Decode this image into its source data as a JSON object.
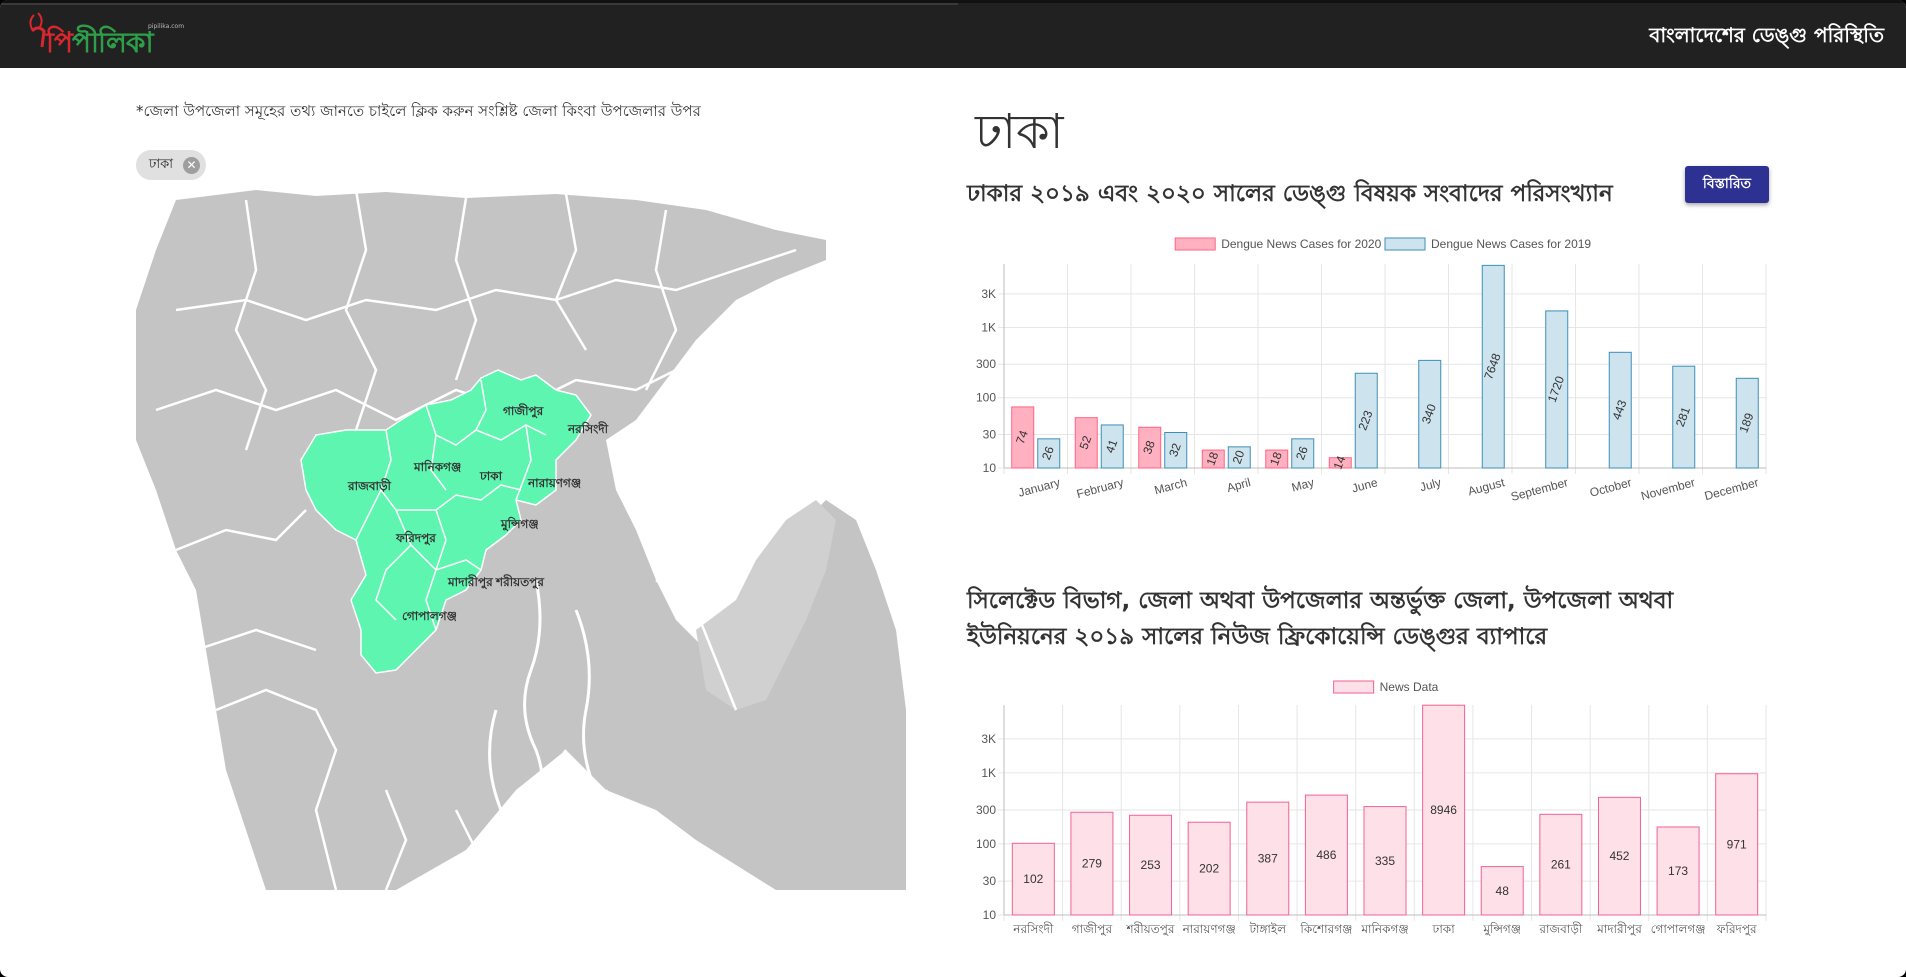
{
  "header": {
    "logo_text_red": "পি",
    "logo_text_green": "পীলিকা",
    "logo_url": "pipilika.com",
    "site_title": "বাংলাদেশের ডেঙ্গু পরিস্থিতি"
  },
  "sidebar": {
    "hint": "*জেলা উপজেলা সমূহের তথ্য জানতে চাইলে ক্লিক করুন সংশ্লিষ্ট জেলা কিংবা উপজেলার উপর",
    "chip_label": "ঢাকা"
  },
  "map": {
    "base_color": "#c4c4c4",
    "selected_color": "#5ef5b0",
    "border_color": "#ffffff",
    "labels": [
      {
        "id": "gazipur",
        "text": "গাজীপুর"
      },
      {
        "id": "narsingdi",
        "text": "নরসিংদী"
      },
      {
        "id": "manikganj",
        "text": "মানিকগঞ্জ"
      },
      {
        "id": "dhaka",
        "text": "ঢাকা"
      },
      {
        "id": "narayanganj",
        "text": "নারায়ণগঞ্জ"
      },
      {
        "id": "rajbari",
        "text": "রাজবাড়ী"
      },
      {
        "id": "munshiganj",
        "text": "মুন্সিগঞ্জ"
      },
      {
        "id": "faridpur",
        "text": "ফরিদপুর"
      },
      {
        "id": "madaripur",
        "text": "মাদারীপুর"
      },
      {
        "id": "shariatpur",
        "text": "শরীয়তপুর"
      },
      {
        "id": "gopalganj",
        "text": "গোপালগঞ্জ"
      }
    ]
  },
  "main": {
    "district_title": "ঢাকা",
    "chart1_heading": "ঢাকার ২০১৯ এবং ২০২০ সালের ডেঙ্গু বিষয়ক সংবাদের পরিসংখ্যান",
    "details_button": "বিস্তারিত",
    "chart2_heading": "সিলেক্টেড বিভাগ, জেলা অথবা উপজেলার অন্তর্ভুক্ত জেলা, উপজেলা অথবা ইউনিয়নের ২০১৯ সালের নিউজ ফ্রিকোয়েন্সি ডেঙ্গুর ব্যাপারে"
  },
  "chart_data": [
    {
      "type": "bar",
      "scale": "log",
      "yticks": [
        "10",
        "30",
        "100",
        "300",
        "1K",
        "3K"
      ],
      "ytick_values": [
        10,
        30,
        100,
        300,
        1000,
        3000
      ],
      "ylim": [
        10,
        8000
      ],
      "grid": true,
      "legend": "top-center",
      "categories": [
        "January",
        "February",
        "March",
        "April",
        "May",
        "June",
        "July",
        "August",
        "September",
        "October",
        "November",
        "December"
      ],
      "series": [
        {
          "name": "Dengue News Cases for 2020",
          "color": "#ff6384",
          "fill": "#ffb1c1",
          "values": [
            74,
            52,
            38,
            18,
            18,
            14,
            null,
            null,
            null,
            null,
            null,
            null
          ]
        },
        {
          "name": "Dengue News Cases for 2019",
          "color": "#3e8fb8",
          "fill": "#cde3ee",
          "values": [
            26,
            41,
            32,
            20,
            26,
            223,
            340,
            7648,
            1720,
            443,
            281,
            189
          ]
        }
      ]
    },
    {
      "type": "bar",
      "scale": "log",
      "yticks": [
        "10",
        "30",
        "100",
        "300",
        "1K",
        "3K"
      ],
      "ytick_values": [
        10,
        30,
        100,
        300,
        1000,
        3000
      ],
      "ylim": [
        10,
        9000
      ],
      "grid": true,
      "legend": "top-center",
      "categories": [
        "নরসিংদী",
        "গাজীপুর",
        "শরীয়তপুর",
        "নারায়ণগঞ্জ",
        "টাঙ্গাইল",
        "কিশোরগঞ্জ",
        "মানিকগঞ্জ",
        "ঢাকা",
        "মুন্সিগঞ্জ",
        "রাজবাড়ী",
        "মাদারীপুর",
        "গোপালগঞ্জ",
        "ফরিদপুর"
      ],
      "series": [
        {
          "name": "News Data",
          "color": "#f06292",
          "fill": "#fde0e8",
          "values": [
            102,
            279,
            253,
            202,
            387,
            486,
            335,
            8946,
            48,
            261,
            452,
            173,
            971
          ]
        }
      ]
    }
  ]
}
